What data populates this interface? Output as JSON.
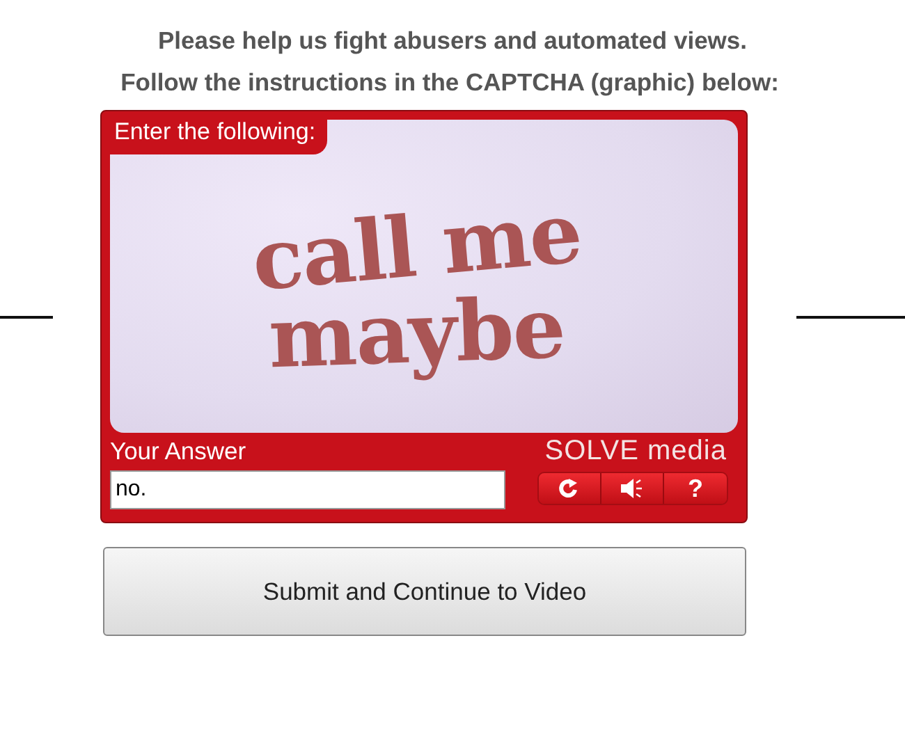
{
  "heading": [
    "Please help us fight abusers and automated views.",
    "Follow the instructions in the CAPTCHA (graphic) below:"
  ],
  "captcha": {
    "prompt": "Enter the following:",
    "challenge": [
      "call me",
      "maybe"
    ],
    "answer_label": "Your Answer",
    "logo": "SOLVE media",
    "answer": {
      "value": "no."
    },
    "help_label": "?"
  },
  "submit": {
    "label": "Submit and Continue to Video"
  }
}
